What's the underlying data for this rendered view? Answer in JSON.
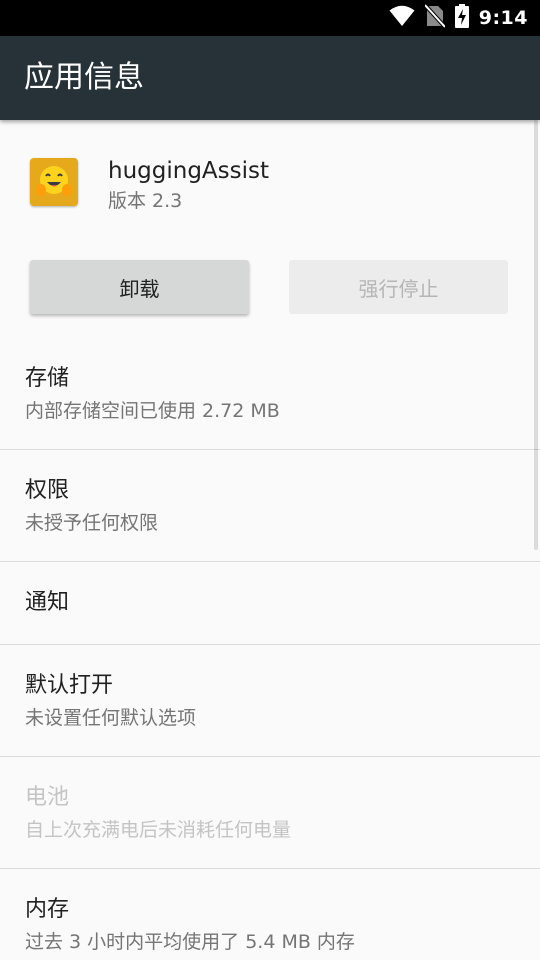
{
  "status_bar": {
    "time": "9:14",
    "icons": [
      "wifi-icon",
      "no-sim-icon",
      "battery-charging-icon"
    ]
  },
  "app_bar": {
    "title": "应用信息"
  },
  "app": {
    "name": "huggingAssist",
    "version": "版本 2.3",
    "icon": "hugging-face-icon",
    "icon_color": "#e5a91b"
  },
  "buttons": {
    "uninstall": "卸载",
    "force_stop": "强行停止"
  },
  "prefs": [
    {
      "title": "存储",
      "summary": "内部存储空间已使用 2.72 MB",
      "enabled": true
    },
    {
      "title": "权限",
      "summary": "未授予任何权限",
      "enabled": true
    },
    {
      "title": "通知",
      "summary": "",
      "enabled": true
    },
    {
      "title": "默认打开",
      "summary": "未设置任何默认选项",
      "enabled": true
    },
    {
      "title": "电池",
      "summary": "自上次充满电后未消耗任何电量",
      "enabled": false
    },
    {
      "title": "内存",
      "summary": "过去 3 小时内平均使用了 5.4 MB 内存",
      "enabled": true
    }
  ],
  "colors": {
    "app_bar": "#263238",
    "status_bar": "#000000",
    "background": "#fafafa"
  }
}
